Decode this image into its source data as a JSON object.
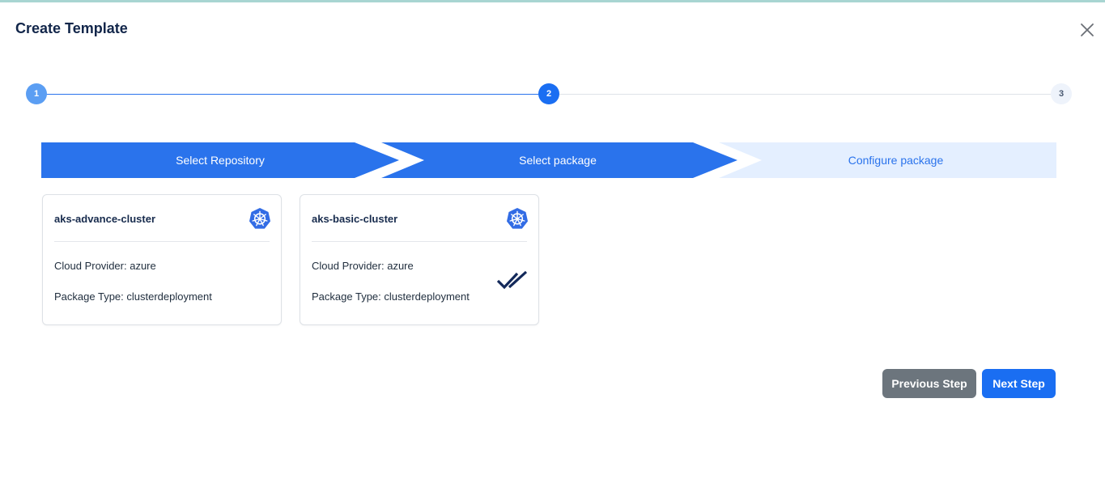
{
  "dialog": {
    "title": "Create Template",
    "close_icon": "close-icon"
  },
  "stepper": {
    "steps": [
      {
        "number": "1",
        "state": "completed"
      },
      {
        "number": "2",
        "state": "active"
      },
      {
        "number": "3",
        "state": "pending"
      }
    ]
  },
  "wizard": {
    "stages": [
      {
        "label": "Select Repository",
        "state": "done"
      },
      {
        "label": "Select package",
        "state": "current"
      },
      {
        "label": "Configure package",
        "state": "upcoming"
      }
    ]
  },
  "packages": [
    {
      "name": "aks-advance-cluster",
      "cloud_provider": "Cloud Provider: azure",
      "package_type": "Package Type: clusterdeployment",
      "icon": "kubernetes-icon",
      "selected": false
    },
    {
      "name": "aks-basic-cluster",
      "cloud_provider": "Cloud Provider: azure",
      "package_type": "Package Type: clusterdeployment",
      "icon": "kubernetes-icon",
      "selected": true,
      "selected_icon": "double-check-icon"
    }
  ],
  "actions": {
    "previous_label": "Previous Step",
    "next_label": "Next Step"
  },
  "colors": {
    "primary": "#2a73ec",
    "light_stage": "#e4efff",
    "completed_dot": "#5b9ef3",
    "check": "#13295a",
    "secondary_button": "#6c757d",
    "primary_button": "#1a6ef2"
  }
}
